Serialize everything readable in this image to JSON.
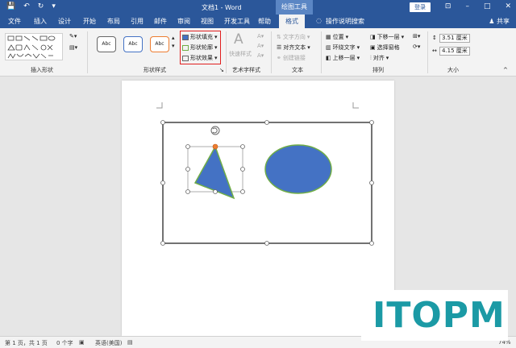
{
  "titlebar": {
    "doc_title": "文档1 - Word",
    "context_tool": "绘图工具",
    "login": "登录"
  },
  "tabs": [
    "文件",
    "插入",
    "设计",
    "开始",
    "布局",
    "引用",
    "邮件",
    "审阅",
    "视图",
    "开发工具",
    "帮助",
    "格式"
  ],
  "active_tab": "格式",
  "search_hint": "操作说明搜索",
  "share": "共享",
  "ribbon": {
    "groups": {
      "insert_shapes": "插入形状",
      "shape_styles": "形状样式",
      "wordart": "艺术字样式",
      "text": "文本",
      "arrange": "排列",
      "size": "大小"
    },
    "style_sample": "Abc",
    "shape_fill": "形状填充",
    "shape_outline": "形状轮廓",
    "shape_effect": "形状效果",
    "quick_styles": "快速样式",
    "text_direction": "文字方向",
    "align_text": "对齐文本",
    "create_link": "创建链接",
    "position": "位置",
    "wrap_text": "环绕文字",
    "bring_forward": "上移一层",
    "send_backward": "下移一层",
    "selection_pane": "选择窗格",
    "align": "对齐",
    "height": "3.51 厘米",
    "width": "4.15 厘米"
  },
  "status": {
    "page": "第 1 页，共 1 页",
    "words": "0 个字",
    "language": "英语(美国)",
    "zoom": "74%"
  },
  "watermark": "ITOPM",
  "colors": {
    "title_blue": "#2b579a",
    "shape_fill": "#4472c4",
    "shape_outline": "#70ad47",
    "highlight": "#e01e1e"
  }
}
